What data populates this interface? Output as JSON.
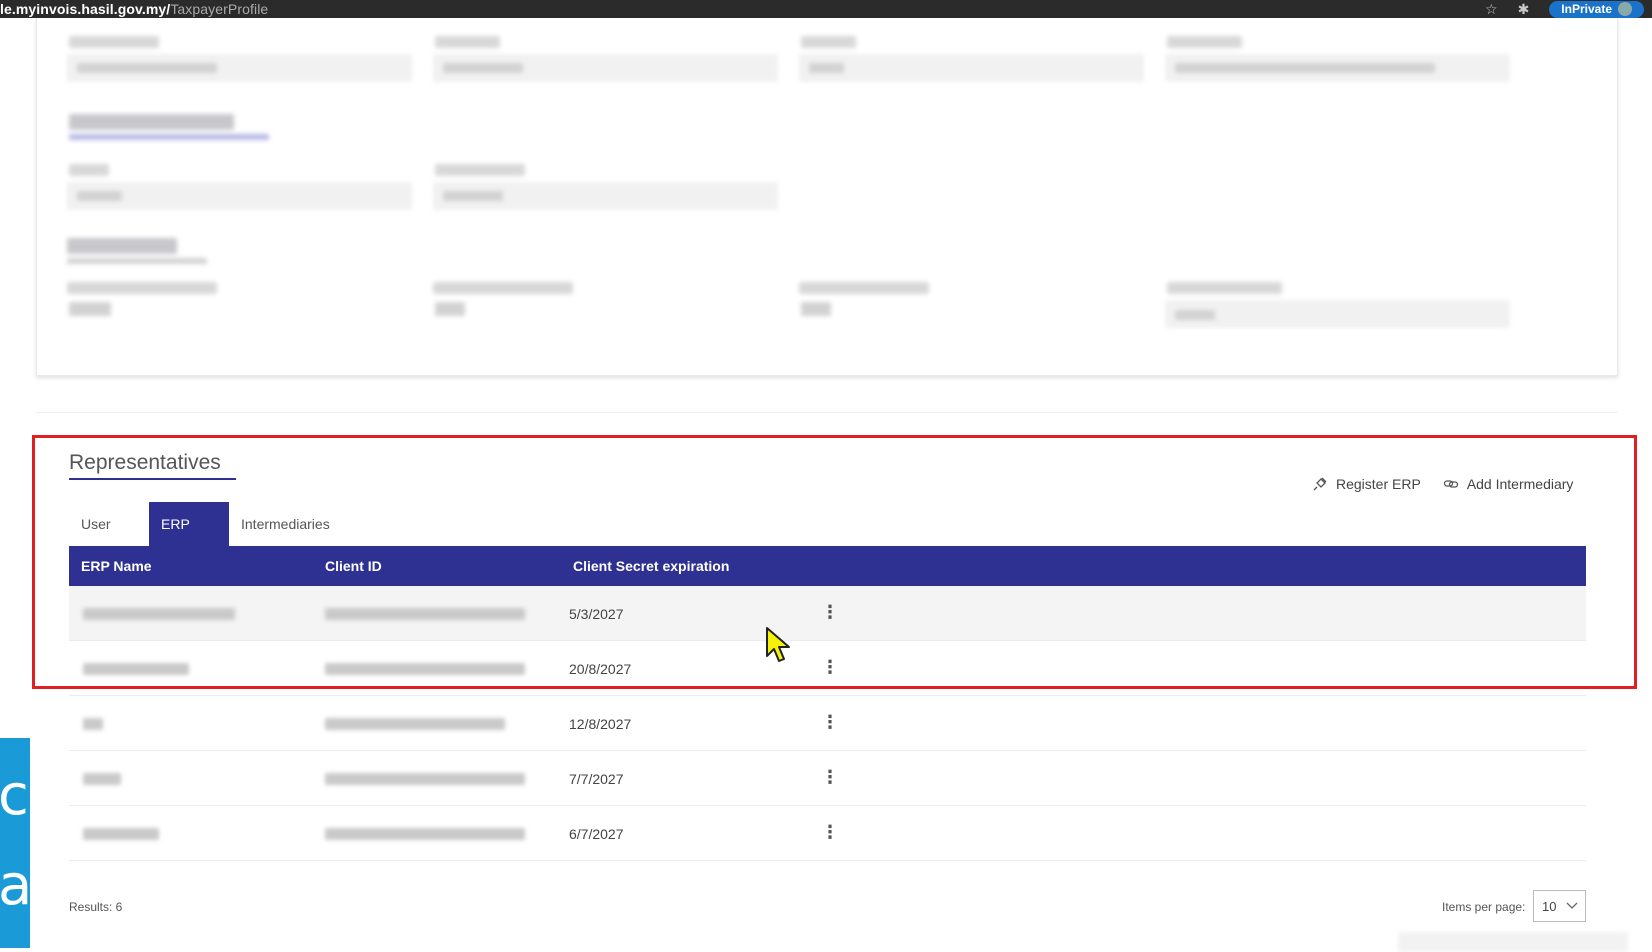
{
  "browser": {
    "url_host": "le.myinvois.hasil.gov.my/",
    "url_path": "TaxpayerProfile",
    "inprivate_label": "InPrivate"
  },
  "left_strip": {
    "letter1": "c",
    "letter2": "a",
    "color": "#1a9bd8"
  },
  "representatives": {
    "title": "Representatives",
    "actions": {
      "register_erp": "Register ERP",
      "add_intermediary": "Add Intermediary"
    },
    "tabs": {
      "user": "User",
      "erp": "ERP",
      "intermediaries": "Intermediaries",
      "active": "ERP"
    },
    "table": {
      "headers": {
        "erp_name": "ERP Name",
        "client_id": "Client ID",
        "client_secret_expiration": "Client Secret expiration"
      },
      "rows": [
        {
          "expiration": "5/3/2027"
        },
        {
          "expiration": "20/8/2027"
        },
        {
          "expiration": "12/8/2027"
        },
        {
          "expiration": "7/7/2027"
        },
        {
          "expiration": "6/7/2027"
        }
      ]
    },
    "results": "Results: 6",
    "items_per_page_label": "Items per page:",
    "items_per_page_value": "10"
  },
  "colors": {
    "accent": "#2e3192",
    "highlight": "#e02020"
  }
}
